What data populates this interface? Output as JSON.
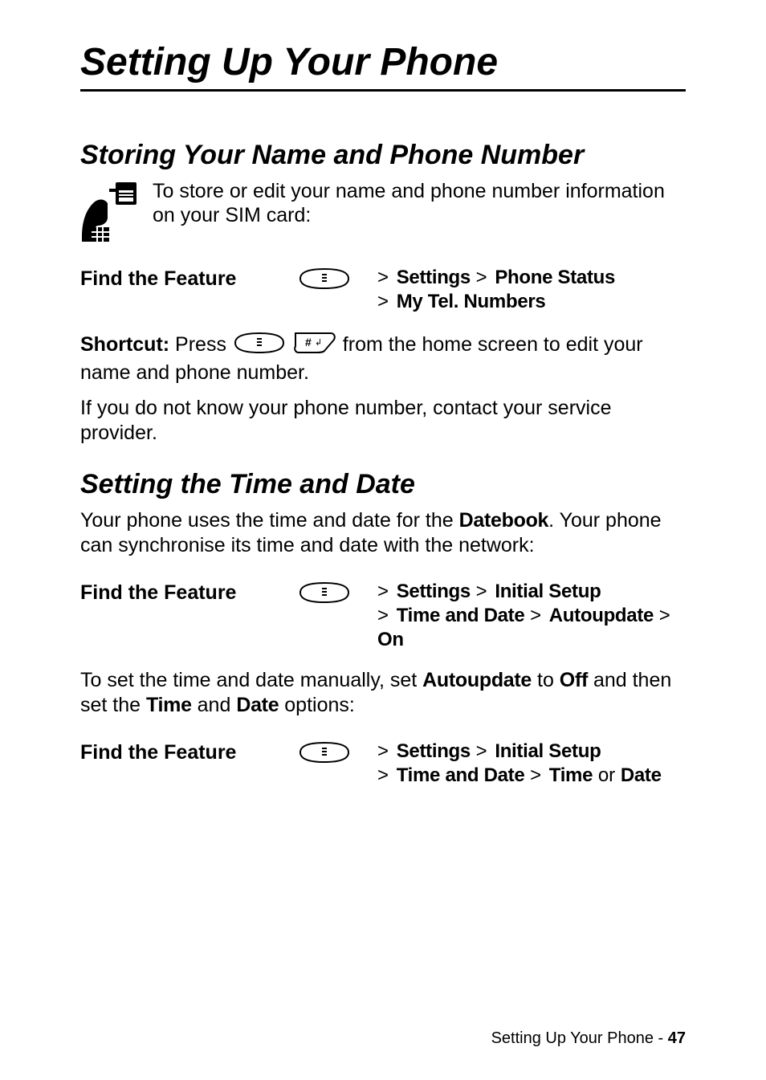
{
  "page_title": "Setting Up Your Phone",
  "section1": {
    "heading": "Storing Your Name and Phone Number",
    "intro": "To store or edit your name and phone number information on your SIM card:",
    "feature_label": "Find the Feature",
    "path_line1_pre": "> ",
    "path_line1_a": "Settings",
    "path_line1_sep": " > ",
    "path_line1_b": "Phone Status",
    "path_line2_pre": "> ",
    "path_line2_a": "My Tel. Numbers",
    "shortcut_label": "Shortcut:",
    "shortcut_pre": " Press ",
    "shortcut_post": " from the home screen to edit your name and phone number.",
    "note": "If you do not know your phone number, contact your service provider."
  },
  "section2": {
    "heading": "Setting the Time and Date",
    "intro_a": "Your phone uses the time and date for the ",
    "intro_b_cond": "Datebook",
    "intro_c": ". Your phone can synchronise its time and date with the network:",
    "featureA_label": "Find the Feature",
    "pathA_line1_pre": "> ",
    "pathA_line1_a": "Settings",
    "pathA_line1_sep": " > ",
    "pathA_line1_b": "Initial Setup",
    "pathA_line2_pre": "> ",
    "pathA_line2_a": "Time and Date",
    "pathA_line2_sep1": " > ",
    "pathA_line2_b": "Autoupdate",
    "pathA_line2_sep2": " > ",
    "pathA_line2_c": "On",
    "manual_pre": "To set the time and date manually, set ",
    "manual_auto": "Autoupdate",
    "manual_mid1": " to ",
    "manual_off": "Off",
    "manual_mid2": " and then set the ",
    "manual_time": "Time",
    "manual_mid3": " and ",
    "manual_date": "Date",
    "manual_post": " options:",
    "featureB_label": "Find the Feature",
    "pathB_line1_pre": "> ",
    "pathB_line1_a": "Settings",
    "pathB_line1_sep": " > ",
    "pathB_line1_b": "Initial Setup",
    "pathB_line2_pre": "> ",
    "pathB_line2_a": "Time and Date",
    "pathB_line2_sep1": " > ",
    "pathB_line2_b": "Time",
    "pathB_line2_or": " or ",
    "pathB_line2_c": "Date"
  },
  "footer": {
    "text": "Setting Up Your Phone - ",
    "page": "47"
  }
}
